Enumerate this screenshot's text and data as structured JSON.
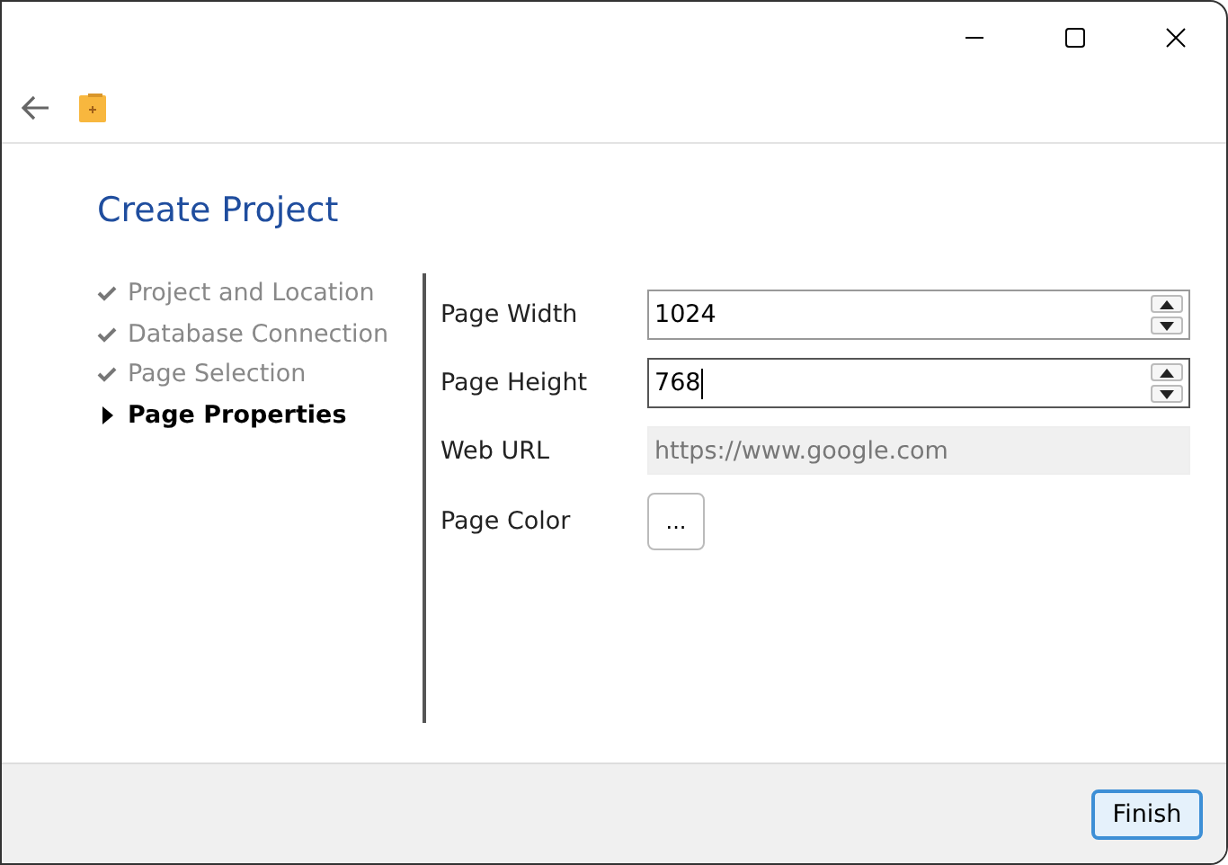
{
  "title": "Create Project",
  "steps": [
    {
      "label": "Project and Location",
      "kind": "done"
    },
    {
      "label": "Database Connection",
      "kind": "done"
    },
    {
      "label": "Page Selection",
      "kind": "done"
    },
    {
      "label": "Page Properties",
      "kind": "current"
    }
  ],
  "fields": [
    {
      "label": "Page Width",
      "kind": "spin",
      "value": "1024",
      "focused": false
    },
    {
      "label": "Page Height",
      "kind": "spin",
      "value": "768",
      "focused": true
    },
    {
      "label": "Web URL",
      "kind": "text",
      "value": "https://www.google.com",
      "disabled": true
    },
    {
      "label": "Page Color",
      "kind": "color",
      "button": "..."
    }
  ],
  "buttons": [
    {
      "label": "Finish",
      "default": true
    }
  ]
}
